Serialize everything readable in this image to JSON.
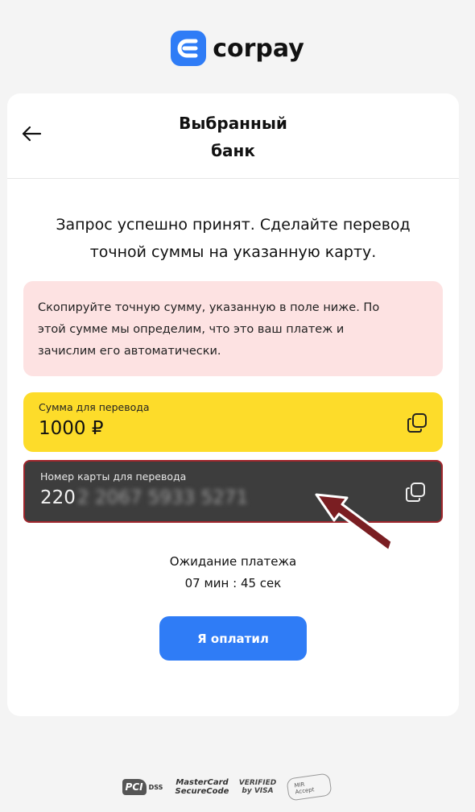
{
  "brand": {
    "name": "corpay",
    "color": "#2f7cf6"
  },
  "header": {
    "title_line1": "Выбранный",
    "title_line2": "банк",
    "back_icon": "arrow-left-icon"
  },
  "message": {
    "line1": "Запрос успешно принят. Сделайте перевод",
    "line2": "точной суммы на указанную карту."
  },
  "notice": {
    "line1": "Скопируйте точную сумму, указанную в поле ниже. По",
    "line2": "этой сумме мы определим, что это ваш платеж и",
    "line3": "зачислим его автоматически.",
    "bg_color": "#fde2e2"
  },
  "amount": {
    "label": "Сумма для перевода",
    "value": "1000 ₽",
    "bg_color": "#fddc2a",
    "copy_icon": "copy-icon"
  },
  "card": {
    "label": "Номер карты для перевода",
    "number_visible": "220",
    "number_obscured": "2 2067 5933 5271",
    "bg_color": "#3d3d3d",
    "highlight_color": "#a0262c",
    "copy_icon": "copy-icon"
  },
  "waiting": {
    "label": "Ожидание платежа",
    "timer": "07 мин : 45 сек"
  },
  "pay_button": {
    "label": "Я оплатил",
    "color": "#2f7cf6"
  },
  "footer_badges": {
    "pci": {
      "mark": "PCI",
      "text": "DSS"
    },
    "mastercard": {
      "line1": "MasterCard",
      "line2": "SecureCode"
    },
    "visa": {
      "line1": "VERIFIED",
      "line2": "by VISA"
    },
    "mir": {
      "text": "MIR Accept"
    }
  }
}
